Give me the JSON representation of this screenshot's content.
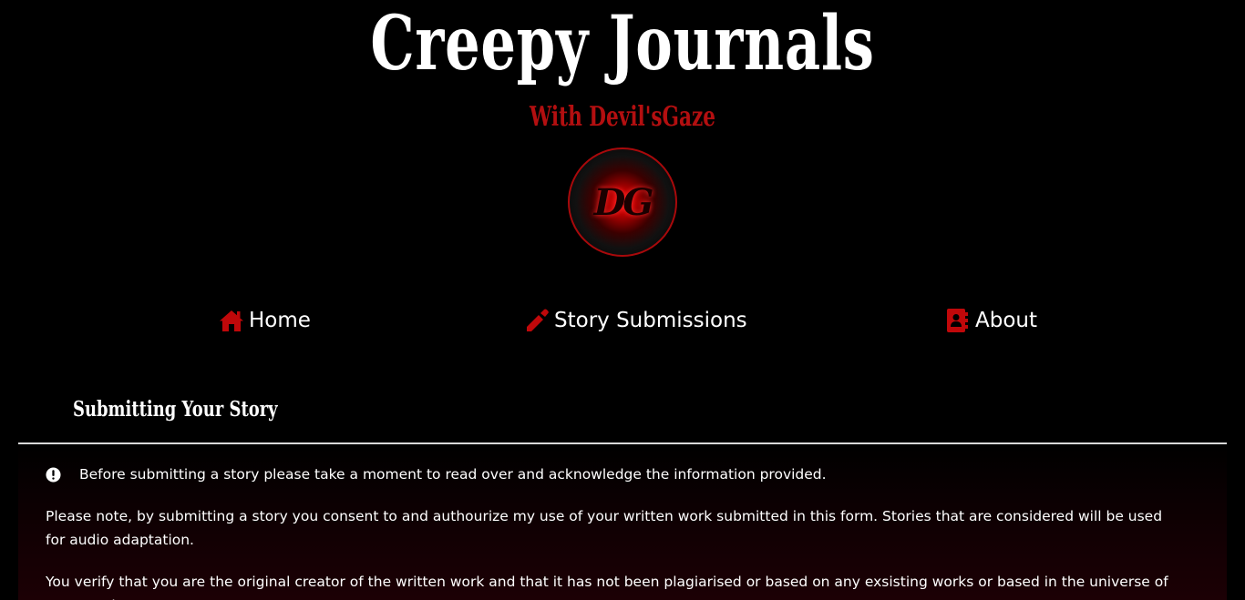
{
  "header": {
    "title": "Creepy Journals",
    "subtitle": "With Devil'sGaze",
    "logo_text": "DG"
  },
  "nav": {
    "items": [
      {
        "label": "Home",
        "icon": "home-icon"
      },
      {
        "label": "Story Submissions",
        "icon": "pencil-icon"
      },
      {
        "label": "About",
        "icon": "contact-card-icon"
      }
    ]
  },
  "section": {
    "title": "Submitting Your Story"
  },
  "content": {
    "notice": "Before submitting a story please take a moment to read over and acknowledge the information provided.",
    "paragraphs": [
      "Please note, by submitting a story you consent to and authourize my use of your written work submitted in this form. Stories that are considered will be used for audio adaptation.",
      "You verify that you are the original creator of the written work and that it has not been plagiarised or based on any exsisting works or based in the universe of any popular"
    ]
  },
  "colors": {
    "background": "#000000",
    "accent_red": "#b30f10",
    "icon_red": "#c0080a",
    "text": "#ffffff",
    "divider": "#d9d9d9"
  }
}
